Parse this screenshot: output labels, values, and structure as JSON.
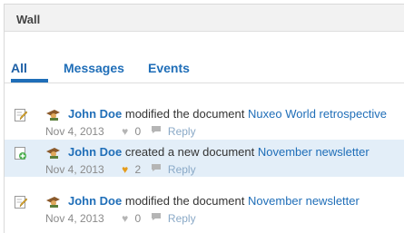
{
  "panel": {
    "title": "Wall"
  },
  "tabs": [
    {
      "label": "All",
      "active": true
    },
    {
      "label": "Messages",
      "active": false
    },
    {
      "label": "Events",
      "active": false
    }
  ],
  "activities": [
    {
      "icon": "edit-document-icon",
      "user": "John Doe",
      "verb": "modified the document",
      "document": "Nuxeo World retrospective",
      "date": "Nov 4, 2013",
      "likes": "0",
      "liked": false,
      "reply_label": "Reply",
      "highlighted": false
    },
    {
      "icon": "new-document-icon",
      "user": "John Doe",
      "verb": "created a new document",
      "document": "November newsletter",
      "date": "Nov 4, 2013",
      "likes": "2",
      "liked": true,
      "reply_label": "Reply",
      "highlighted": true
    },
    {
      "icon": "edit-document-icon",
      "user": "John Doe",
      "verb": "modified the document",
      "document": "November newsletter",
      "date": "Nov 4, 2013",
      "likes": "0",
      "liked": false,
      "reply_label": "Reply",
      "highlighted": false
    }
  ],
  "colors": {
    "link": "#1f6eb8",
    "highlight_row": "#e3eef8",
    "like_active": "#e59c1c"
  }
}
